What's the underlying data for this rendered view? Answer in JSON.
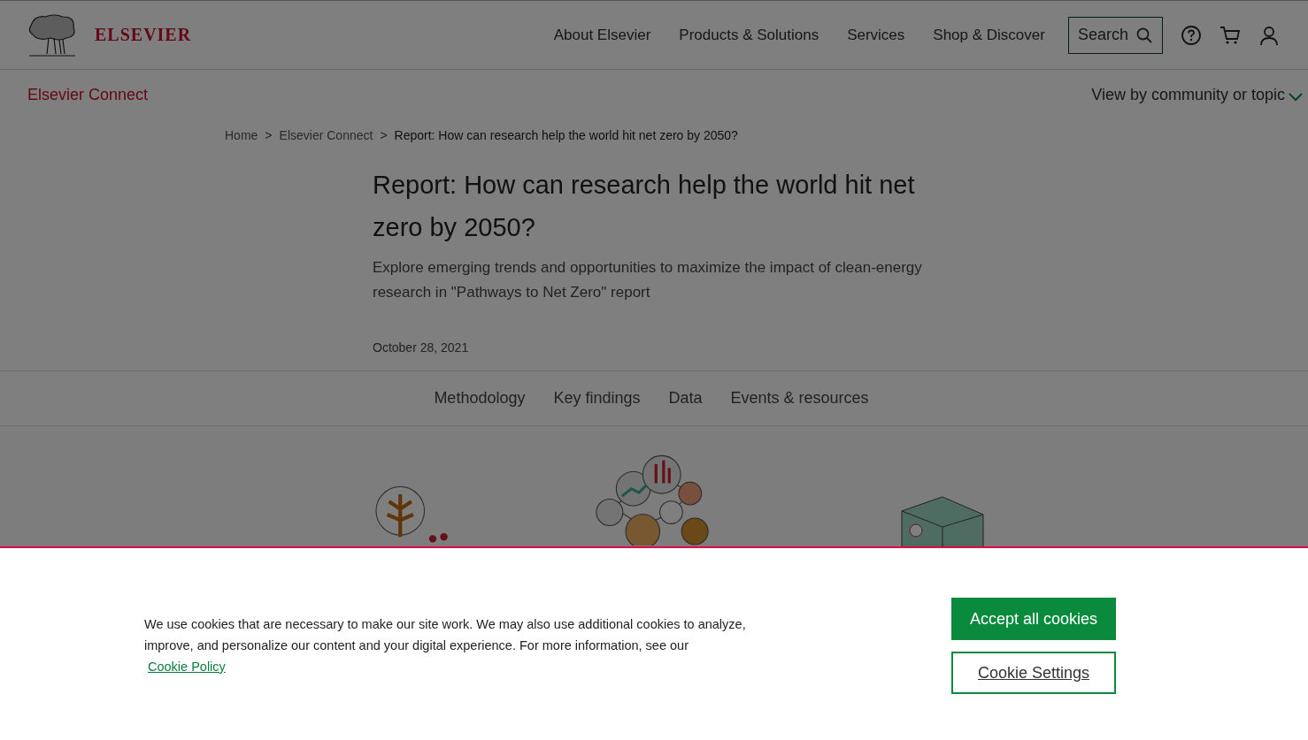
{
  "header": {
    "brand": "ELSEVIER",
    "nav": [
      "About Elsevier",
      "Products & Solutions",
      "Services",
      "Shop & Discover"
    ],
    "search_label": "Search"
  },
  "subnav": {
    "title": "Elsevier Connect",
    "menu": "View by community or topic"
  },
  "breadcrumb_separator": ">",
  "breadcrumb": [
    "Home",
    "Elsevier Connect",
    "Report: How can research help the world hit net zero by 2050?"
  ],
  "article": {
    "title": "Report: How can research help the world hit net zero by 2050?",
    "subtitle": "Explore emerging trends and opportunities to maximize the impact of clean-energy research in \"Pathways to Net Zero\" report",
    "date": "October 28, 2021"
  },
  "section_tabs": [
    "Methodology",
    "Key findings",
    "Data",
    "Events & resources"
  ],
  "cookie_banner": {
    "text": "We use cookies that are necessary to make our site work. We may also use additional cookies to analyze, improve, and personalize our content and your digital experience. For more information, see our",
    "link": "Cookie Policy",
    "accept": "Accept all cookies",
    "settings": "Cookie Settings"
  }
}
